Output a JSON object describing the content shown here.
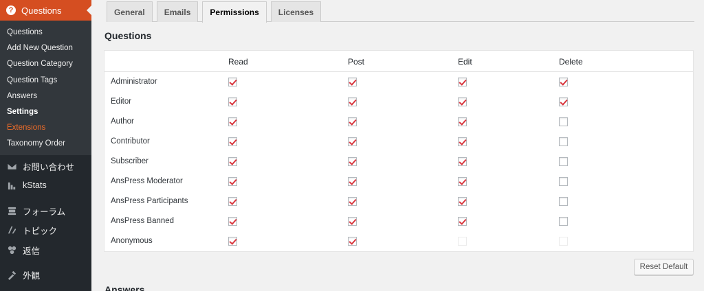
{
  "sidebar": {
    "current_menu": "Questions",
    "submenu": [
      {
        "label": "Questions",
        "state": "normal"
      },
      {
        "label": "Add New Question",
        "state": "normal"
      },
      {
        "label": "Question Category",
        "state": "normal"
      },
      {
        "label": "Question Tags",
        "state": "normal"
      },
      {
        "label": "Answers",
        "state": "normal"
      },
      {
        "label": "Settings",
        "state": "active"
      },
      {
        "label": "Extensions",
        "state": "highlight"
      },
      {
        "label": "Taxonomy Order",
        "state": "normal"
      }
    ],
    "menu": [
      {
        "label": "お問い合わせ",
        "icon": "mail-icon"
      },
      {
        "label": "kStats",
        "icon": "stats-icon"
      },
      {
        "label": "フォーラム",
        "icon": "forum-icon"
      },
      {
        "label": "トピック",
        "icon": "topic-icon"
      },
      {
        "label": "返信",
        "icon": "reply-icon"
      },
      {
        "label": "外観",
        "icon": "appearance-icon"
      }
    ]
  },
  "tabs": [
    {
      "label": "General",
      "active": false
    },
    {
      "label": "Emails",
      "active": false
    },
    {
      "label": "Permissions",
      "active": true
    },
    {
      "label": "Licenses",
      "active": false
    }
  ],
  "section_title": "Questions",
  "table": {
    "columns": [
      "Read",
      "Post",
      "Edit",
      "Delete"
    ],
    "rows": [
      {
        "role": "Administrator",
        "perms": [
          "checked",
          "checked",
          "checked",
          "checked"
        ]
      },
      {
        "role": "Editor",
        "perms": [
          "checked",
          "checked",
          "checked",
          "checked"
        ]
      },
      {
        "role": "Author",
        "perms": [
          "checked",
          "checked",
          "checked",
          "unchecked"
        ]
      },
      {
        "role": "Contributor",
        "perms": [
          "checked",
          "checked",
          "checked",
          "unchecked"
        ]
      },
      {
        "role": "Subscriber",
        "perms": [
          "checked",
          "checked",
          "checked",
          "unchecked"
        ]
      },
      {
        "role": "AnsPress Moderator",
        "perms": [
          "checked",
          "checked",
          "checked",
          "unchecked"
        ]
      },
      {
        "role": "AnsPress Participants",
        "perms": [
          "checked",
          "checked",
          "checked",
          "unchecked"
        ]
      },
      {
        "role": "AnsPress Banned",
        "perms": [
          "checked",
          "checked",
          "checked",
          "unchecked"
        ]
      },
      {
        "role": "Anonymous",
        "perms": [
          "checked",
          "checked",
          "disabled",
          "disabled"
        ]
      }
    ]
  },
  "reset_button": "Reset Default",
  "next_section_title": "Answers",
  "colors": {
    "sidebar_bg": "#23282d",
    "submenu_bg": "#32373c",
    "accent": "#d54e21",
    "highlight": "#f56e28",
    "check": "#d9363e"
  }
}
